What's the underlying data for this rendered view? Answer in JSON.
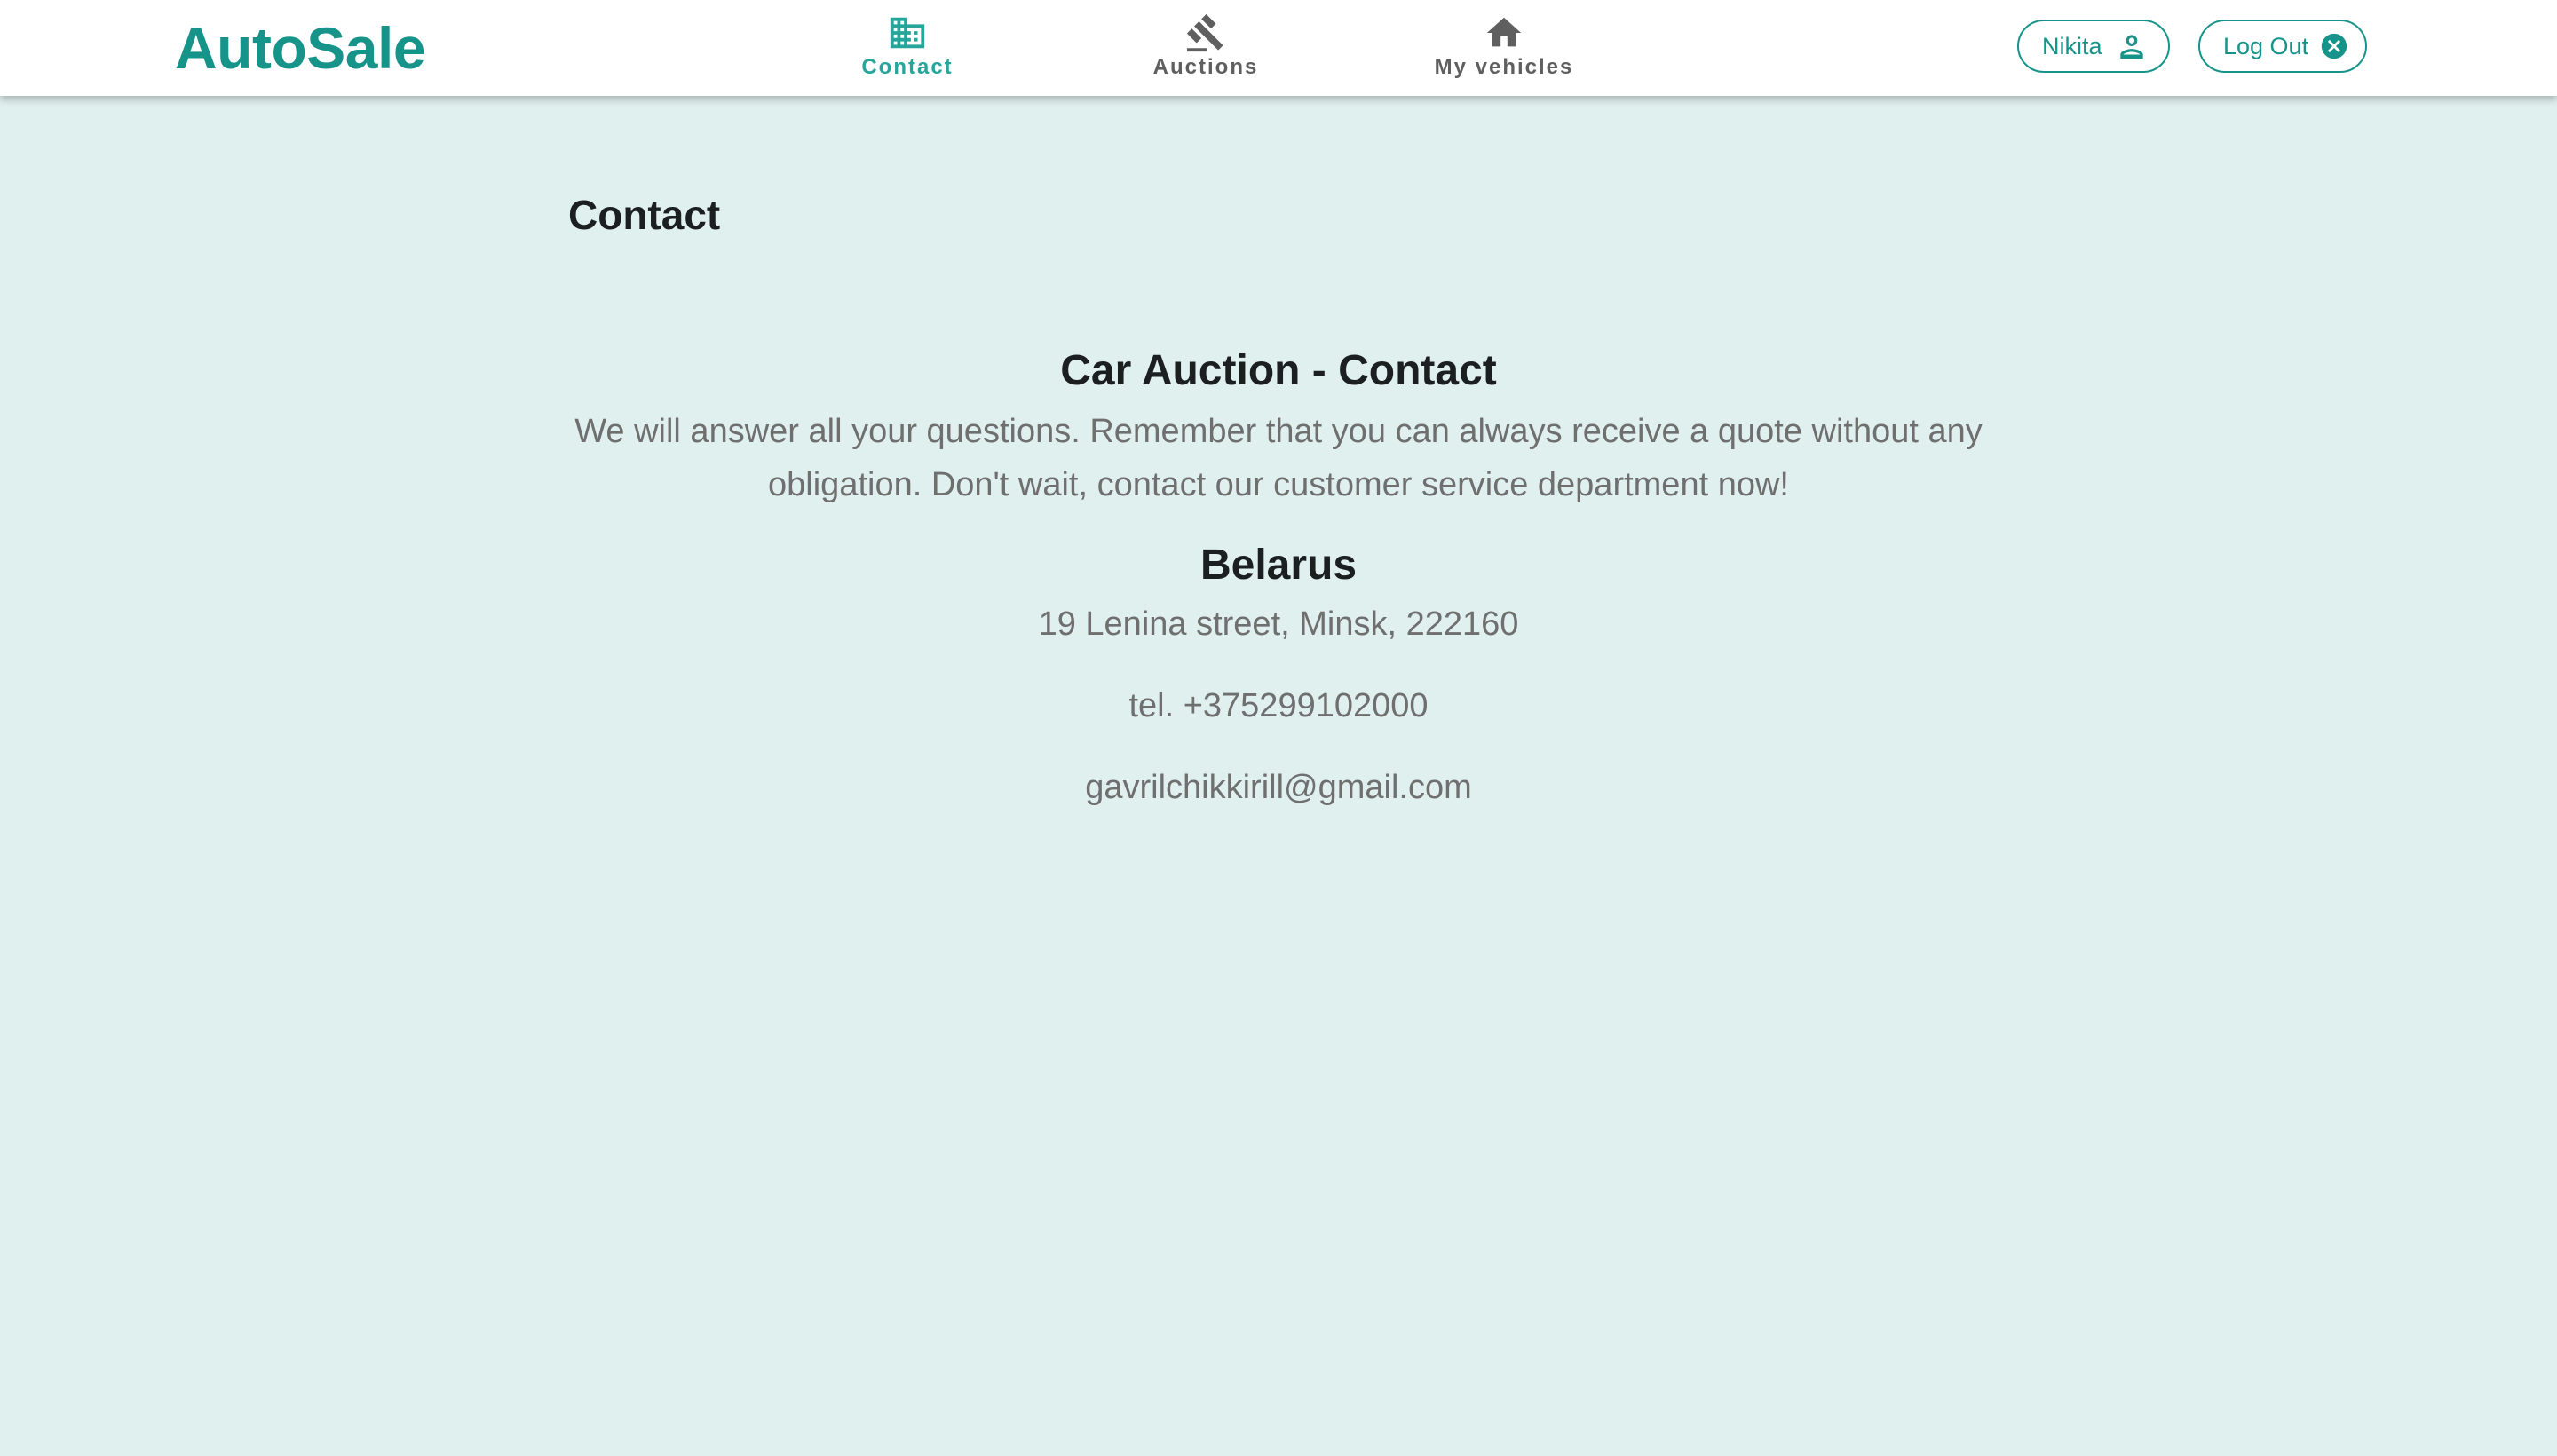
{
  "brand": {
    "logo": "AutoSale",
    "color": "#17948a"
  },
  "nav": {
    "items": [
      {
        "label": "Contact",
        "icon": "building-icon",
        "active": true
      },
      {
        "label": "Auctions",
        "icon": "gavel-icon",
        "active": false
      },
      {
        "label": "My vehicles",
        "icon": "home-icon",
        "active": false
      }
    ]
  },
  "user": {
    "name": "Nikita",
    "icon": "person-icon"
  },
  "logout": {
    "label": "Log Out",
    "icon": "close-circle-icon"
  },
  "page": {
    "title": "Contact"
  },
  "contact": {
    "heading": "Car Auction - Contact",
    "intro": "We will answer all your questions. Remember that you can always receive a quote without any obligation. Don't wait, contact our customer service department now!",
    "country": "Belarus",
    "address": "19 Lenina street, Minsk, 222160",
    "phone": "tel. +375299102000",
    "email": "gavrilchikkirill@gmail.com"
  },
  "colors": {
    "accent": "#17948a",
    "background": "#e0f0ef",
    "nav_inactive": "#5f5f5f"
  }
}
